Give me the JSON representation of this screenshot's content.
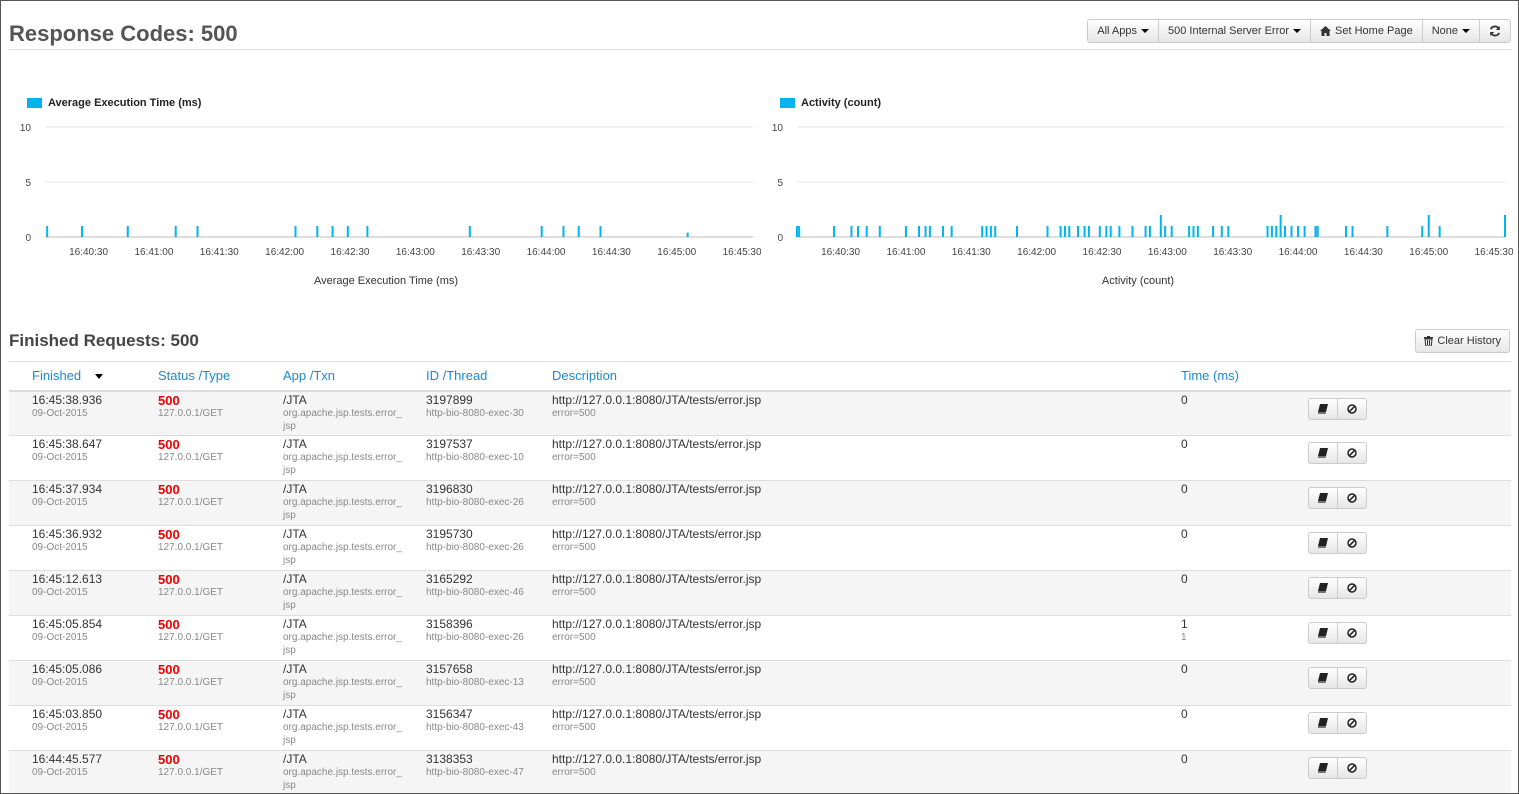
{
  "header": {
    "title": "Response Codes: 500",
    "buttons": {
      "apps": "All Apps",
      "status": "500 Internal Server Error",
      "home": "Set Home Page",
      "none": "None"
    }
  },
  "chart_data": [
    {
      "type": "bar",
      "title": "Average Execution Time (ms)",
      "legend": "Average Execution Time (ms)",
      "xlabel": "Average Execution Time (ms)",
      "ylabel": "",
      "ylim": [
        0,
        10
      ],
      "yticks": [
        "0",
        "5",
        "10"
      ],
      "xticks": [
        "16:40:30",
        "16:41:00",
        "16:41:30",
        "16:42:00",
        "16:42:30",
        "16:43:00",
        "16:43:30",
        "16:44:00",
        "16:44:30",
        "16:45:00",
        "16:45:30"
      ],
      "xrange": [
        "16:40:10",
        "16:45:35"
      ],
      "color": "#00b4f0",
      "series": [
        {
          "x": [
            "16:40:11",
            "16:40:27",
            "16:40:48",
            "16:41:10",
            "16:41:20",
            "16:42:05",
            "16:42:15",
            "16:42:22",
            "16:42:29",
            "16:42:38",
            "16:43:25",
            "16:43:58",
            "16:44:08",
            "16:44:15",
            "16:44:25",
            "16:45:05"
          ],
          "values": [
            1,
            1,
            1,
            1,
            1,
            1,
            1,
            1,
            1,
            1,
            1,
            1,
            1,
            1,
            1,
            0.4
          ]
        }
      ]
    },
    {
      "type": "bar",
      "title": "Activity (count)",
      "legend": "Activity (count)",
      "xlabel": "Activity (count)",
      "ylabel": "",
      "ylim": [
        0,
        10
      ],
      "yticks": [
        "0",
        "5",
        "10"
      ],
      "xticks": [
        "16:40:30",
        "16:41:00",
        "16:41:30",
        "16:42:00",
        "16:42:30",
        "16:43:00",
        "16:43:30",
        "16:44:00",
        "16:44:30",
        "16:45:00",
        "16:45:30"
      ],
      "xrange": [
        "16:40:10",
        "16:45:35"
      ],
      "color": "#00b4f0",
      "series": [
        {
          "x": [
            "16:40:10",
            "16:40:11",
            "16:40:27",
            "16:40:35",
            "16:40:38",
            "16:40:42",
            "16:40:48",
            "16:41:00",
            "16:41:06",
            "16:41:09",
            "16:41:11",
            "16:41:17",
            "16:41:21",
            "16:41:35",
            "16:41:37",
            "16:41:39",
            "16:41:41",
            "16:41:51",
            "16:42:05",
            "16:42:11",
            "16:42:13",
            "16:42:15",
            "16:42:19",
            "16:42:22",
            "16:42:24",
            "16:42:29",
            "16:42:32",
            "16:42:34",
            "16:42:38",
            "16:42:44",
            "16:42:50",
            "16:42:52",
            "16:42:57",
            "16:42:59",
            "16:43:02",
            "16:43:10",
            "16:43:12",
            "16:43:14",
            "16:43:21",
            "16:43:25",
            "16:43:28",
            "16:43:46",
            "16:43:48",
            "16:43:50",
            "16:43:52",
            "16:43:54",
            "16:43:57",
            "16:44:00",
            "16:44:03",
            "16:44:08",
            "16:44:09",
            "16:44:22",
            "16:44:25",
            "16:44:41",
            "16:44:57",
            "16:45:00",
            "16:45:05",
            "16:45:35"
          ],
          "values": [
            1,
            1,
            1,
            1,
            1,
            1,
            1,
            1,
            1,
            1,
            1,
            1,
            1,
            1,
            1,
            1,
            1,
            1,
            1,
            1,
            1,
            1,
            1,
            1,
            1,
            1,
            1,
            1,
            1,
            1,
            1,
            1,
            2,
            1,
            1,
            1,
            1,
            1,
            1,
            1,
            1,
            1,
            1,
            1,
            2,
            1,
            1,
            1,
            1,
            1,
            1,
            1,
            1,
            1,
            1,
            2,
            1,
            2
          ]
        }
      ]
    }
  ],
  "finished": {
    "title": "Finished Requests: 500",
    "clear_label": "Clear History",
    "columns": [
      "Finished",
      "Status /Type",
      "App /Txn",
      "ID /Thread",
      "Description",
      "Time (ms)"
    ],
    "rows": [
      {
        "time": "16:45:38.936",
        "date": "09-Oct-2015",
        "status": "500",
        "type": "127.0.0.1/GET",
        "app": "/JTA",
        "txn": "org.apache.jsp.tests.error_jsp",
        "id": "3197899",
        "thread": "http-bio-8080-exec-30",
        "url": "http://127.0.0.1:8080/JTA/tests/error.jsp",
        "desc": "error=500",
        "ms": "0",
        "ms_sub": ""
      },
      {
        "time": "16:45:38.647",
        "date": "09-Oct-2015",
        "status": "500",
        "type": "127.0.0.1/GET",
        "app": "/JTA",
        "txn": "org.apache.jsp.tests.error_jsp",
        "id": "3197537",
        "thread": "http-bio-8080-exec-10",
        "url": "http://127.0.0.1:8080/JTA/tests/error.jsp",
        "desc": "error=500",
        "ms": "0",
        "ms_sub": ""
      },
      {
        "time": "16:45:37.934",
        "date": "09-Oct-2015",
        "status": "500",
        "type": "127.0.0.1/GET",
        "app": "/JTA",
        "txn": "org.apache.jsp.tests.error_jsp",
        "id": "3196830",
        "thread": "http-bio-8080-exec-26",
        "url": "http://127.0.0.1:8080/JTA/tests/error.jsp",
        "desc": "error=500",
        "ms": "0",
        "ms_sub": ""
      },
      {
        "time": "16:45:36.932",
        "date": "09-Oct-2015",
        "status": "500",
        "type": "127.0.0.1/GET",
        "app": "/JTA",
        "txn": "org.apache.jsp.tests.error_jsp",
        "id": "3195730",
        "thread": "http-bio-8080-exec-26",
        "url": "http://127.0.0.1:8080/JTA/tests/error.jsp",
        "desc": "error=500",
        "ms": "0",
        "ms_sub": ""
      },
      {
        "time": "16:45:12.613",
        "date": "09-Oct-2015",
        "status": "500",
        "type": "127.0.0.1/GET",
        "app": "/JTA",
        "txn": "org.apache.jsp.tests.error_jsp",
        "id": "3165292",
        "thread": "http-bio-8080-exec-46",
        "url": "http://127.0.0.1:8080/JTA/tests/error.jsp",
        "desc": "error=500",
        "ms": "0",
        "ms_sub": ""
      },
      {
        "time": "16:45:05.854",
        "date": "09-Oct-2015",
        "status": "500",
        "type": "127.0.0.1/GET",
        "app": "/JTA",
        "txn": "org.apache.jsp.tests.error_jsp",
        "id": "3158396",
        "thread": "http-bio-8080-exec-26",
        "url": "http://127.0.0.1:8080/JTA/tests/error.jsp",
        "desc": "error=500",
        "ms": "1",
        "ms_sub": "1"
      },
      {
        "time": "16:45:05.086",
        "date": "09-Oct-2015",
        "status": "500",
        "type": "127.0.0.1/GET",
        "app": "/JTA",
        "txn": "org.apache.jsp.tests.error_jsp",
        "id": "3157658",
        "thread": "http-bio-8080-exec-13",
        "url": "http://127.0.0.1:8080/JTA/tests/error.jsp",
        "desc": "error=500",
        "ms": "0",
        "ms_sub": ""
      },
      {
        "time": "16:45:03.850",
        "date": "09-Oct-2015",
        "status": "500",
        "type": "127.0.0.1/GET",
        "app": "/JTA",
        "txn": "org.apache.jsp.tests.error_jsp",
        "id": "3156347",
        "thread": "http-bio-8080-exec-43",
        "url": "http://127.0.0.1:8080/JTA/tests/error.jsp",
        "desc": "error=500",
        "ms": "0",
        "ms_sub": ""
      },
      {
        "time": "16:44:45.577",
        "date": "09-Oct-2015",
        "status": "500",
        "type": "127.0.0.1/GET",
        "app": "/JTA",
        "txn": "org.apache.jsp.tests.error_jsp",
        "id": "3138353",
        "thread": "http-bio-8080-exec-47",
        "url": "http://127.0.0.1:8080/JTA/tests/error.jsp",
        "desc": "error=500",
        "ms": "0",
        "ms_sub": ""
      }
    ]
  }
}
